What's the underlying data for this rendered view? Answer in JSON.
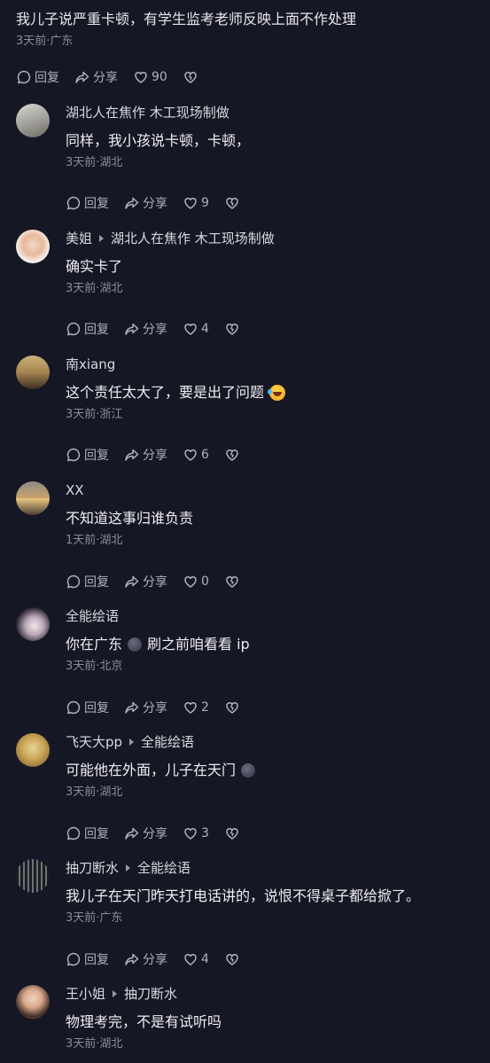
{
  "parent": {
    "text": "我儿子说严重卡顿，有学生监考老师反映上面不作处理",
    "meta": "3天前·广东",
    "reply_label": "回复",
    "share_label": "分享",
    "likes": "90"
  },
  "replies": [
    {
      "author": "湖北人在焦作 木工现场制做",
      "reply_to": "",
      "text": "同样，我小孩说卡顿，卡顿，",
      "meta": "3天前·湖北",
      "likes": "9"
    },
    {
      "author": "美姐",
      "reply_to": "湖北人在焦作 木工现场制做",
      "text": "确实卡了",
      "meta": "3天前·湖北",
      "likes": "4"
    },
    {
      "author": "南xiang",
      "reply_to": "",
      "text": "这个责任太大了，要是出了问题",
      "meta": "3天前·浙江",
      "likes": "6"
    },
    {
      "author": "XX",
      "reply_to": "",
      "text": "不知道这事归谁负责",
      "meta": "1天前·湖北",
      "likes": "0"
    },
    {
      "author": "全能绘语",
      "reply_to": "",
      "text_a": "你在广东",
      "text_b": "刷之前咱看看 ip",
      "meta": "3天前·北京",
      "likes": "2"
    },
    {
      "author": "飞天大pp",
      "reply_to": "全能绘语",
      "text": "可能他在外面，儿子在天门",
      "meta": "3天前·湖北",
      "likes": "3"
    },
    {
      "author": "抽刀断水",
      "reply_to": "全能绘语",
      "text": "我儿子在天门昨天打电话讲的，说恨不得桌子都给掀了。",
      "meta": "3天前·广东",
      "likes": "4"
    },
    {
      "author": "王小姐",
      "reply_to": "抽刀断水",
      "text": "物理考完，不是有试听吗",
      "meta": "3天前·湖北",
      "likes": ""
    }
  ],
  "icons": {
    "reply": "comment-bubble-icon",
    "share": "share-arrow-icon",
    "like": "heart-icon",
    "dislike": "broken-heart-icon"
  },
  "colors": {
    "background": "#161724",
    "text": "#eeeef1",
    "muted": "#8a8b96"
  }
}
